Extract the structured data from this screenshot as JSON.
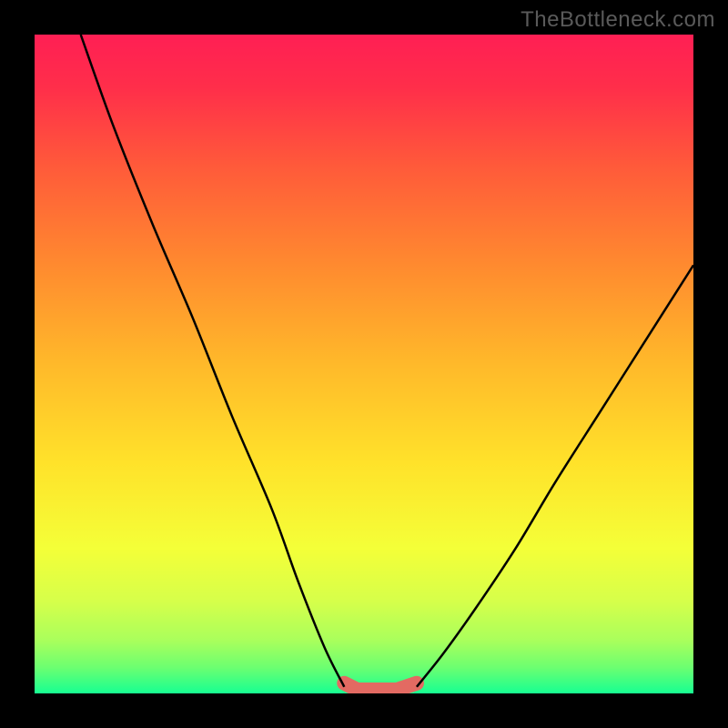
{
  "watermark": "TheBottleneck.com",
  "colors": {
    "frame": "#000000",
    "watermark_text": "#5a5a5a",
    "curve_stroke": "#000000",
    "floor_band": "#e36a62",
    "gradient_stops": [
      {
        "offset": "0%",
        "color": "#ff1f54"
      },
      {
        "offset": "8%",
        "color": "#ff2e4a"
      },
      {
        "offset": "20%",
        "color": "#ff5a3a"
      },
      {
        "offset": "35%",
        "color": "#ff8a2f"
      },
      {
        "offset": "50%",
        "color": "#ffb92a"
      },
      {
        "offset": "65%",
        "color": "#ffe22a"
      },
      {
        "offset": "78%",
        "color": "#f4ff38"
      },
      {
        "offset": "86%",
        "color": "#d6ff4a"
      },
      {
        "offset": "92%",
        "color": "#a9ff5c"
      },
      {
        "offset": "96%",
        "color": "#6dff70"
      },
      {
        "offset": "100%",
        "color": "#17ff92"
      }
    ]
  },
  "chart_data": {
    "type": "line",
    "title": "",
    "xlabel": "",
    "ylabel": "",
    "xlim": [
      0,
      100
    ],
    "ylim": [
      0,
      100
    ],
    "series": [
      {
        "name": "left-curve",
        "x": [
          7,
          12,
          18,
          24,
          30,
          36,
          40,
          44,
          47
        ],
        "values": [
          100,
          86,
          71,
          57,
          42,
          28,
          17,
          7,
          1
        ]
      },
      {
        "name": "right-curve",
        "x": [
          58,
          62,
          67,
          73,
          79,
          86,
          93,
          100
        ],
        "values": [
          1,
          6,
          13,
          22,
          32,
          43,
          54,
          65
        ]
      },
      {
        "name": "floor-band",
        "x": [
          47,
          49,
          52,
          55,
          58
        ],
        "values": [
          1,
          0,
          0,
          0,
          1
        ]
      }
    ],
    "annotations": []
  }
}
